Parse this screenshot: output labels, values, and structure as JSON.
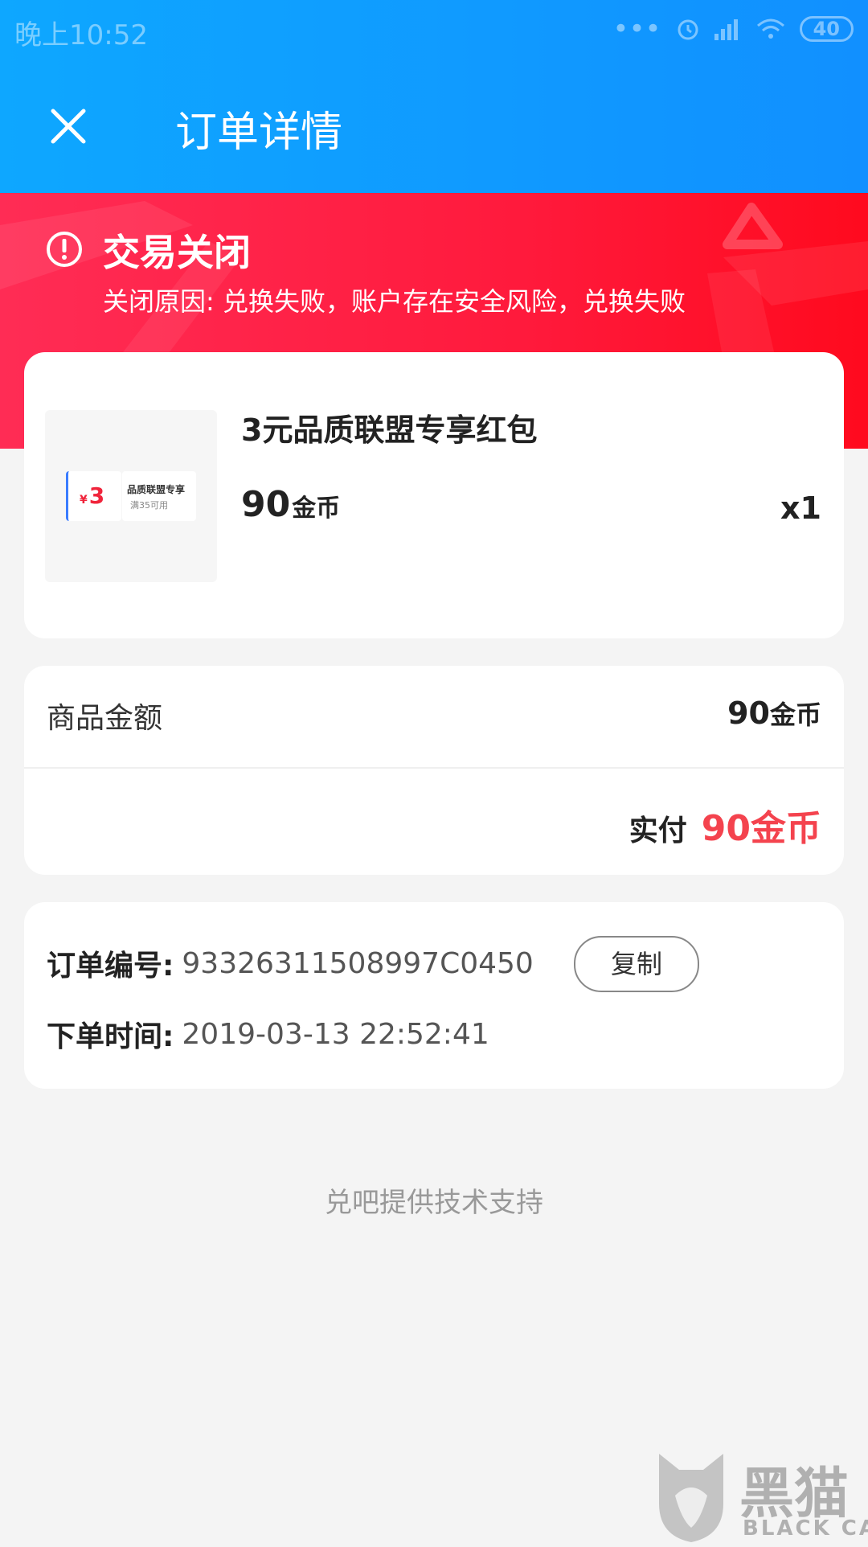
{
  "status_bar": {
    "time": "晚上10:52",
    "battery": "40",
    "dots": "•••"
  },
  "header": {
    "title": "订单详情"
  },
  "banner": {
    "title": "交易关闭",
    "reason": "关闭原因: 兑换失败，账户存在安全风险，兑换失败"
  },
  "product": {
    "name": "3元品质联盟专享红包",
    "price": "90",
    "price_unit": "金币",
    "quantity": "x1",
    "thumbnail": {
      "currency": "¥",
      "value": "3",
      "name": "品质联盟专享",
      "condition": "满35可用"
    }
  },
  "amount": {
    "label": "商品金额",
    "value": "90",
    "unit": "金币",
    "paid_label": "实付",
    "paid_value": "90金币"
  },
  "order": {
    "number_label": "订单编号:",
    "number": "93326311508997C0450",
    "copy_label": "复制",
    "time_label": "下单时间:",
    "time": "2019-03-13 22:52:41"
  },
  "footer": {
    "text": "兑吧提供技术支持"
  },
  "watermark": {
    "text": "黑猫",
    "sub": "BLACK CAT"
  },
  "colors": {
    "nav_blue": "#1190ff",
    "banner_red": "#ff1a3c",
    "accent_red": "#f4434e"
  }
}
